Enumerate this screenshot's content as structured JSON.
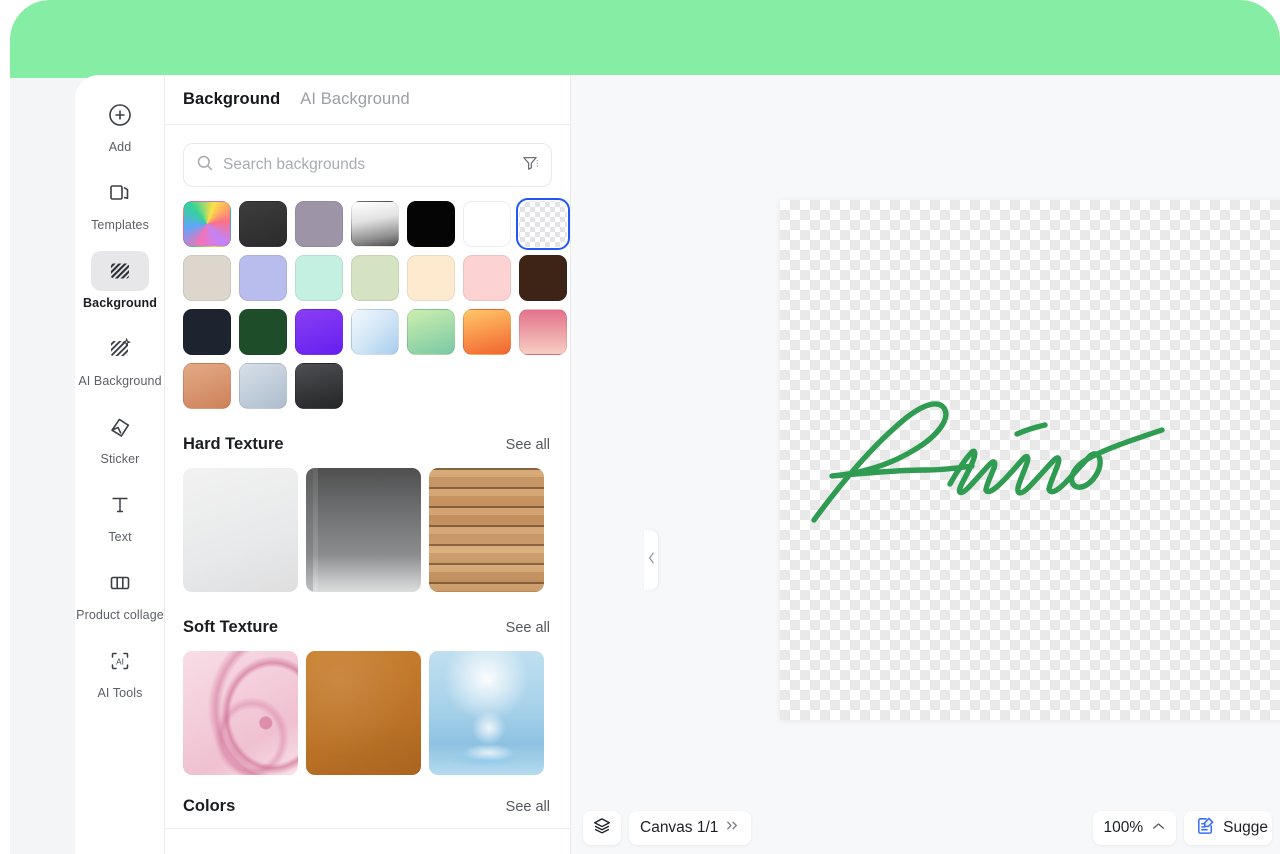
{
  "theme": {
    "backdrop_green": "#86eda5",
    "page_bg": "#f4f5f7",
    "accent_blue": "#2158f5",
    "signature_green": "#2f9c52"
  },
  "sidebar": {
    "items": [
      {
        "label": "Add",
        "icon": "plus-circle-icon",
        "active": false
      },
      {
        "label": "Templates",
        "icon": "templates-icon",
        "active": false
      },
      {
        "label": "Background",
        "icon": "background-hatch-icon",
        "active": true
      },
      {
        "label": "AI Background",
        "icon": "ai-background-icon",
        "active": false
      },
      {
        "label": "Sticker",
        "icon": "sticker-icon",
        "active": false
      },
      {
        "label": "Text",
        "icon": "text-t-icon",
        "active": false
      },
      {
        "label": "Product collage",
        "icon": "product-collage-icon",
        "active": false
      },
      {
        "label": "AI Tools",
        "icon": "ai-tools-icon",
        "active": false
      }
    ]
  },
  "panel": {
    "tabs": [
      {
        "label": "Background",
        "active": true
      },
      {
        "label": "AI Background",
        "active": false
      }
    ],
    "search": {
      "placeholder": "Search backgrounds",
      "value": "",
      "icon": "search-icon",
      "filter_icon": "filter-funnel-icon"
    },
    "swatches": [
      {
        "name": "rainbow-gradient",
        "selected": false,
        "css": "conic-gradient(from 200deg, #f472b6, #60a5fa, #34d399, #fde047, #fb7185, #c084fc, #f472b6)"
      },
      {
        "name": "dark-gray-gradient",
        "selected": false,
        "css": "linear-gradient(160deg,#3d3d3d,#2b2b2b)"
      },
      {
        "name": "mauve-solid",
        "selected": false,
        "css": "#9d94a8"
      },
      {
        "name": "white-to-black-gradient",
        "selected": false,
        "css": "linear-gradient(170deg,#ffffff,#e3e3e3 40%,#8e8e8e 78%,#4a4a4a)"
      },
      {
        "name": "black-solid",
        "selected": false,
        "css": "#050505"
      },
      {
        "name": "white-solid",
        "selected": false,
        "css": "#ffffff"
      },
      {
        "name": "transparent-checker",
        "selected": true,
        "css": "checker"
      },
      {
        "name": "beige-solid",
        "selected": false,
        "css": "#dcd6cd"
      },
      {
        "name": "periwinkle-solid",
        "selected": false,
        "css": "#b9bdee"
      },
      {
        "name": "mint-solid",
        "selected": false,
        "css": "#c4f0e2"
      },
      {
        "name": "sage-solid",
        "selected": false,
        "css": "#d5e3c2"
      },
      {
        "name": "cream-solid",
        "selected": false,
        "css": "#fdeacf"
      },
      {
        "name": "blush-pink-solid",
        "selected": false,
        "css": "#fcd3d2"
      },
      {
        "name": "dark-brown-solid",
        "selected": false,
        "css": "#3e2417"
      },
      {
        "name": "navy-ink-solid",
        "selected": false,
        "css": "#1d2430"
      },
      {
        "name": "forest-green-solid",
        "selected": false,
        "css": "#1e4d29"
      },
      {
        "name": "violet-gradient",
        "selected": false,
        "css": "linear-gradient(160deg,#8b3ef5,#6520ef)"
      },
      {
        "name": "sky-blue-gradient",
        "selected": false,
        "css": "linear-gradient(135deg,#f2f8fd,#d2e6f7 50%,#a8cdec)"
      },
      {
        "name": "green-mint-gradient",
        "selected": false,
        "css": "linear-gradient(160deg,#cdeeaf,#79c9a4)"
      },
      {
        "name": "orange-gradient",
        "selected": false,
        "css": "linear-gradient(165deg,#ffc768,#f2642f)"
      },
      {
        "name": "rose-gradient",
        "selected": false,
        "css": "linear-gradient(180deg,#e4728c,#f6cfc2)"
      },
      {
        "name": "terracotta-gradient",
        "selected": false,
        "css": "linear-gradient(160deg,#e3ab86,#ce8159)"
      },
      {
        "name": "steel-blue-gradient",
        "selected": false,
        "css": "linear-gradient(150deg,#d7e0e9,#adbccd)"
      },
      {
        "name": "charcoal-gradient",
        "selected": false,
        "css": "linear-gradient(165deg,#4d4f52,#242527)"
      }
    ],
    "sections": [
      {
        "title": "Hard Texture",
        "see_all": "See all",
        "thumbs": [
          {
            "name": "marble-texture",
            "cls": "tx-marble"
          },
          {
            "name": "concrete-texture",
            "cls": "tx-concrete"
          },
          {
            "name": "wood-plank-texture",
            "cls": "tx-wood"
          }
        ]
      },
      {
        "title": "Soft Texture",
        "see_all": "See all",
        "thumbs": [
          {
            "name": "pink-silk-texture",
            "cls": "tx-silk"
          },
          {
            "name": "leather-texture",
            "cls": "tx-leather"
          },
          {
            "name": "water-splash-texture",
            "cls": "tx-water"
          }
        ]
      },
      {
        "title": "Colors",
        "see_all": "See all",
        "thumbs": []
      }
    ],
    "collapse_icon": "chevron-left-icon"
  },
  "canvas": {
    "artwork_text": "Primo",
    "background": "transparent-checkerboard"
  },
  "bottombar": {
    "layers_icon": "layers-stack-icon",
    "canvas_label": "Canvas 1/1",
    "canvas_expand_icon": "chevron-double-right-icon",
    "zoom_label": "100%",
    "zoom_chevron_icon": "chevron-up-icon",
    "suggest_label": "Sugge",
    "suggest_icon": "suggest-edit-icon"
  }
}
